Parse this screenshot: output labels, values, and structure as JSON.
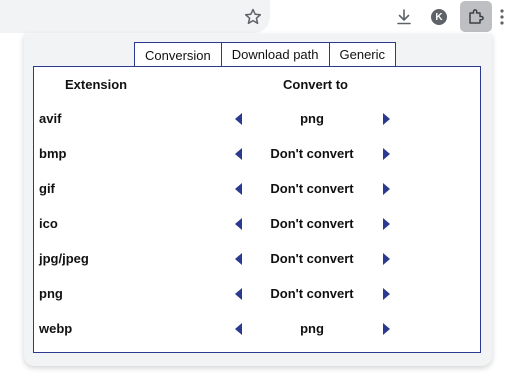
{
  "toolbar": {
    "avatar_letter": "K"
  },
  "tabs": [
    {
      "label": "Conversion",
      "active": true
    },
    {
      "label": "Download path",
      "active": false
    },
    {
      "label": "Generic",
      "active": false
    }
  ],
  "table": {
    "header_extension": "Extension",
    "header_convert": "Convert to",
    "rows": [
      {
        "ext": "avif",
        "value": "png"
      },
      {
        "ext": "bmp",
        "value": "Don't convert"
      },
      {
        "ext": "gif",
        "value": "Don't convert"
      },
      {
        "ext": "ico",
        "value": "Don't convert"
      },
      {
        "ext": "jpg/jpeg",
        "value": "Don't convert"
      },
      {
        "ext": "png",
        "value": "Don't convert"
      },
      {
        "ext": "webp",
        "value": "png"
      }
    ]
  },
  "colors": {
    "accent": "#2b3a8f",
    "arrow": "#2b3a8f"
  }
}
